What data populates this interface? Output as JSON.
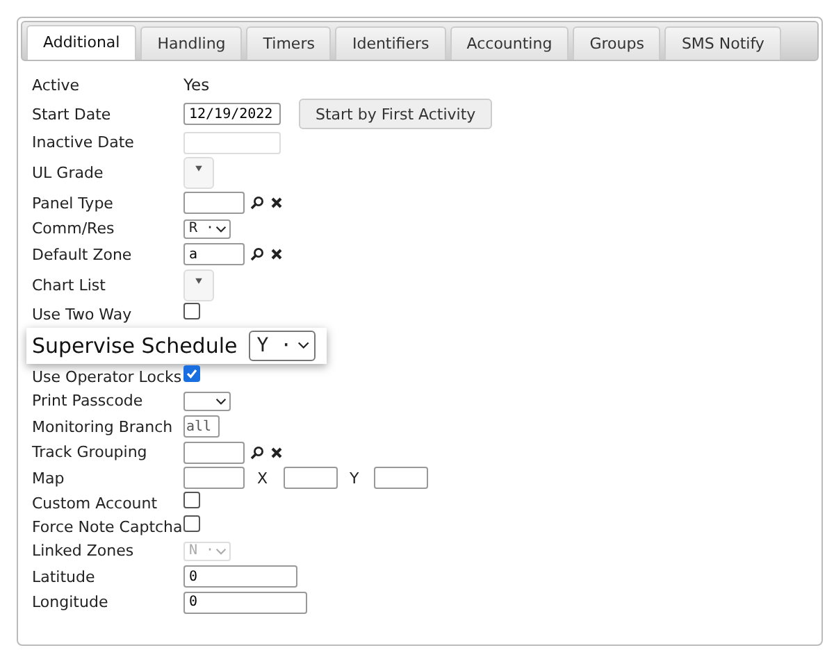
{
  "tabs": [
    {
      "label": "Additional",
      "selected": true
    },
    {
      "label": "Handling",
      "selected": false
    },
    {
      "label": "Timers",
      "selected": false
    },
    {
      "label": "Identifiers",
      "selected": false
    },
    {
      "label": "Accounting",
      "selected": false
    },
    {
      "label": "Groups",
      "selected": false
    },
    {
      "label": "SMS Notify",
      "selected": false
    }
  ],
  "fields": [
    {
      "kind": "text",
      "label": "Active",
      "value": "Yes"
    },
    {
      "kind": "date",
      "label": "Start Date",
      "value": "12/19/2022",
      "button": "Start by First Activity"
    },
    {
      "kind": "date",
      "label": "Inactive Date",
      "disabled": true
    },
    {
      "kind": "list",
      "label": "UL Grade"
    },
    {
      "kind": "lookup",
      "label": "Panel Type"
    },
    {
      "kind": "select",
      "label": "Comm/Res",
      "value": "R ·",
      "disabled": false
    },
    {
      "kind": "lookup",
      "label": "Default Zone",
      "value": "a"
    },
    {
      "kind": "list",
      "label": "Chart List"
    },
    {
      "kind": "checkbox",
      "label": "Use Two Way",
      "checked": false
    },
    {
      "kind": "callout",
      "label": "Supervise Schedule",
      "value": "Y ·"
    },
    {
      "kind": "checkbox",
      "label": "Use Operator Locks",
      "checked": true
    },
    {
      "kind": "select",
      "label": "Print Passcode",
      "disabled": false
    },
    {
      "kind": "code",
      "label": "Monitoring Branch",
      "value": "all"
    },
    {
      "kind": "lookup",
      "label": "Track Grouping"
    },
    {
      "kind": "map",
      "label": "Map",
      "x_label": "X",
      "y_label": "Y"
    },
    {
      "kind": "checkbox",
      "label": "Custom Account",
      "checked": false
    },
    {
      "kind": "checkbox",
      "label": "Force Note Captcha",
      "checked": false
    },
    {
      "kind": "select",
      "label": "Linked Zones",
      "value": "N ·",
      "disabled": true
    },
    {
      "kind": "number",
      "label": "Latitude",
      "value": "0"
    },
    {
      "kind": "number",
      "label": "Longitude",
      "value": "0"
    }
  ]
}
